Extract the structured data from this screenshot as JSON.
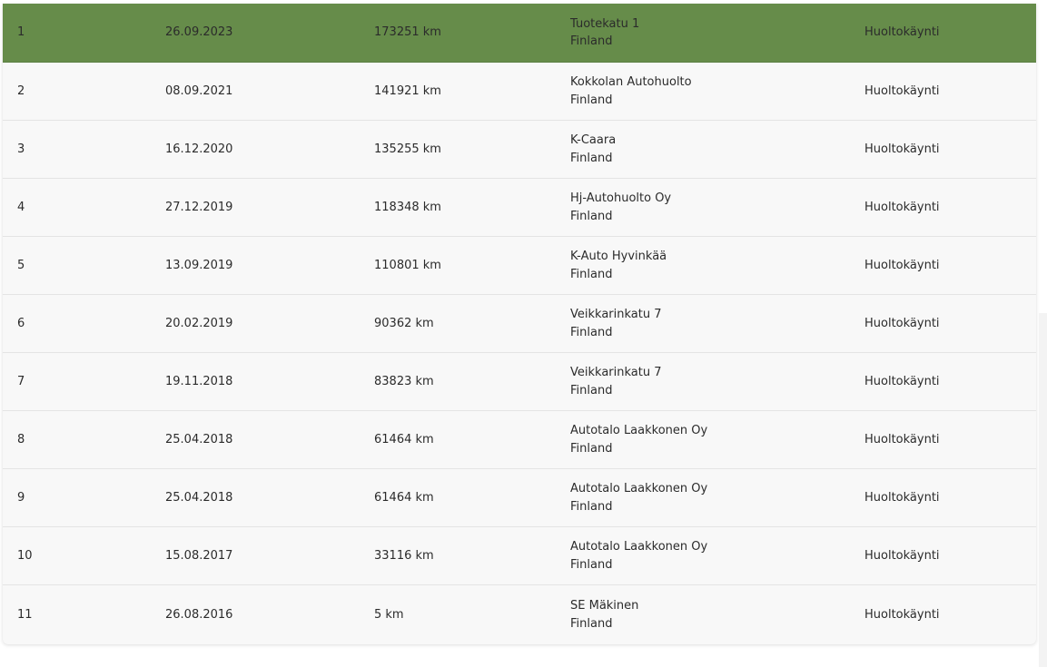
{
  "service_history": {
    "rows": [
      {
        "num": "1",
        "date": "26.09.2023",
        "km": "173251 km",
        "location": "Tuotekatu 1",
        "country": "Finland",
        "type": "Huoltokäynti",
        "selected": true
      },
      {
        "num": "2",
        "date": "08.09.2021",
        "km": "141921 km",
        "location": "Kokkolan Autohuolto",
        "country": "Finland",
        "type": "Huoltokäynti",
        "selected": false
      },
      {
        "num": "3",
        "date": "16.12.2020",
        "km": "135255 km",
        "location": "K-Caara",
        "country": "Finland",
        "type": "Huoltokäynti",
        "selected": false
      },
      {
        "num": "4",
        "date": "27.12.2019",
        "km": "118348 km",
        "location": "Hj-Autohuolto Oy",
        "country": "Finland",
        "type": "Huoltokäynti",
        "selected": false
      },
      {
        "num": "5",
        "date": "13.09.2019",
        "km": "110801 km",
        "location": "K-Auto Hyvinkää",
        "country": "Finland",
        "type": "Huoltokäynti",
        "selected": false
      },
      {
        "num": "6",
        "date": "20.02.2019",
        "km": "90362 km",
        "location": "Veikkarinkatu 7",
        "country": "Finland",
        "type": "Huoltokäynti",
        "selected": false
      },
      {
        "num": "7",
        "date": "19.11.2018",
        "km": "83823 km",
        "location": "Veikkarinkatu 7",
        "country": "Finland",
        "type": "Huoltokäynti",
        "selected": false
      },
      {
        "num": "8",
        "date": "25.04.2018",
        "km": "61464 km",
        "location": "Autotalo Laakkonen Oy",
        "country": "Finland",
        "type": "Huoltokäynti",
        "selected": false
      },
      {
        "num": "9",
        "date": "25.04.2018",
        "km": "61464 km",
        "location": "Autotalo Laakkonen Oy",
        "country": "Finland",
        "type": "Huoltokäynti",
        "selected": false
      },
      {
        "num": "10",
        "date": "15.08.2017",
        "km": "33116 km",
        "location": "Autotalo Laakkonen Oy",
        "country": "Finland",
        "type": "Huoltokäynti",
        "selected": false
      },
      {
        "num": "11",
        "date": "26.08.2016",
        "km": "5 km",
        "location": "SE Mäkinen",
        "country": "Finland",
        "type": "Huoltokäynti",
        "selected": false
      }
    ]
  },
  "colors": {
    "selected_row": "#668c4a",
    "row_background": "#f8f8f8",
    "row_divider": "#e4e4e4",
    "text": "#2b2b2b"
  }
}
